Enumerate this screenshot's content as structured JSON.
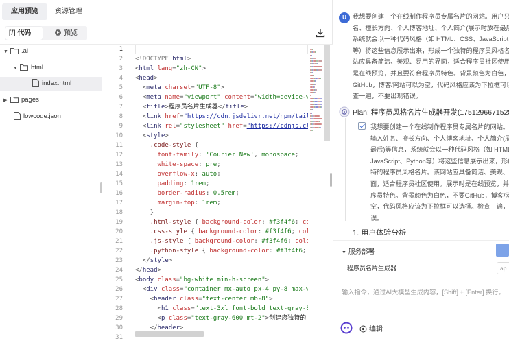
{
  "tabs": {
    "preview": "应用预览",
    "resources": "资源管理"
  },
  "view_switch": {
    "code": "[/] 代码",
    "preview": "预览"
  },
  "file_tree": {
    "items": [
      {
        "label": ".ai",
        "kind": "folder",
        "caret": "▼"
      },
      {
        "label": "html",
        "kind": "folder",
        "caret": "▼"
      },
      {
        "label": "index.html",
        "kind": "file",
        "caret": ""
      },
      {
        "label": "pages",
        "kind": "folder",
        "caret": "▶"
      },
      {
        "label": "lowcode.json",
        "kind": "file",
        "caret": ""
      }
    ]
  },
  "editor": {
    "active_line": 1,
    "line_numbers": [
      "1",
      "2",
      "3",
      "4",
      "5",
      "6",
      "7",
      "8",
      "9",
      "10",
      "11",
      "12",
      "13",
      "14",
      "15",
      "16",
      "17",
      "18",
      "19",
      "20",
      "21",
      "22",
      "23",
      "24",
      "25",
      "26",
      "27",
      "28",
      "29",
      "30",
      "31"
    ],
    "lines": [
      [],
      [
        [
          "tk-doct",
          "<!DOCTYPE "
        ],
        [
          "tk-tag",
          "html"
        ],
        [
          "tk-doct",
          ">"
        ]
      ],
      [
        [
          "tk-punct",
          "<"
        ],
        [
          "tk-tag",
          "html "
        ],
        [
          "tk-attr",
          "lang"
        ],
        [
          "tk-punct",
          "="
        ],
        [
          "tk-str",
          "\"zh-CN\""
        ],
        [
          "tk-punct",
          ">"
        ]
      ],
      [
        [
          "tk-punct",
          "<"
        ],
        [
          "tk-tag",
          "head"
        ],
        [
          "tk-punct",
          ">"
        ]
      ],
      [
        [
          "tk-punct",
          "  <"
        ],
        [
          "tk-tag",
          "meta "
        ],
        [
          "tk-attr",
          "charset"
        ],
        [
          "tk-punct",
          "="
        ],
        [
          "tk-str",
          "\"UTF-8\""
        ],
        [
          "tk-punct",
          ">"
        ]
      ],
      [
        [
          "tk-punct",
          "  <"
        ],
        [
          "tk-tag",
          "meta "
        ],
        [
          "tk-attr",
          "name"
        ],
        [
          "tk-punct",
          "="
        ],
        [
          "tk-str",
          "\"viewport\" "
        ],
        [
          "tk-attr",
          "content"
        ],
        [
          "tk-punct",
          "="
        ],
        [
          "tk-str",
          "\"width=device-width, initial-scale=1.0\""
        ]
      ],
      [
        [
          "tk-punct",
          "  <"
        ],
        [
          "tk-tag",
          "title"
        ],
        [
          "tk-punct",
          ">"
        ],
        [
          "tk-text",
          "程序员名片生成器"
        ],
        [
          "tk-punct",
          "</"
        ],
        [
          "tk-tag",
          "title"
        ],
        [
          "tk-punct",
          ">"
        ]
      ],
      [
        [
          "tk-punct",
          "  <"
        ],
        [
          "tk-tag",
          "link "
        ],
        [
          "tk-attr",
          "href"
        ],
        [
          "tk-punct",
          "="
        ],
        [
          "tk-link",
          "\"https://cdn.jsdelivr.net/npm/tailwindcss\""
        ]
      ],
      [
        [
          "tk-punct",
          "  <"
        ],
        [
          "tk-tag",
          "link "
        ],
        [
          "tk-attr",
          "rel"
        ],
        [
          "tk-punct",
          "="
        ],
        [
          "tk-str",
          "\"stylesheet\" "
        ],
        [
          "tk-attr",
          "href"
        ],
        [
          "tk-punct",
          "="
        ],
        [
          "tk-link",
          "\"https://cdnjs.cloudflare.com\""
        ]
      ],
      [
        [
          "tk-punct",
          "  <"
        ],
        [
          "tk-tag",
          "style"
        ],
        [
          "tk-punct",
          ">"
        ]
      ],
      [
        [
          "tk-sel",
          "    .code-style "
        ],
        [
          "tk-punct",
          "{"
        ]
      ],
      [
        [
          "tk-prop",
          "      font-family"
        ],
        [
          "tk-punct",
          ": "
        ],
        [
          "tk-val",
          "'Courier New'"
        ],
        [
          "tk-punct",
          ", "
        ],
        [
          "tk-val",
          "monospace"
        ],
        [
          "tk-punct",
          ";"
        ]
      ],
      [
        [
          "tk-prop",
          "      white-space"
        ],
        [
          "tk-punct",
          ": "
        ],
        [
          "tk-val",
          "pre"
        ],
        [
          "tk-punct",
          ";"
        ]
      ],
      [
        [
          "tk-prop",
          "      overflow-x"
        ],
        [
          "tk-punct",
          ": "
        ],
        [
          "tk-val",
          "auto"
        ],
        [
          "tk-punct",
          ";"
        ]
      ],
      [
        [
          "tk-prop",
          "      padding"
        ],
        [
          "tk-punct",
          ": "
        ],
        [
          "tk-val",
          "1rem"
        ],
        [
          "tk-punct",
          ";"
        ]
      ],
      [
        [
          "tk-prop",
          "      border-radius"
        ],
        [
          "tk-punct",
          ": "
        ],
        [
          "tk-val",
          "0.5rem"
        ],
        [
          "tk-punct",
          ";"
        ]
      ],
      [
        [
          "tk-prop",
          "      margin-top"
        ],
        [
          "tk-punct",
          ": "
        ],
        [
          "tk-val",
          "1rem"
        ],
        [
          "tk-punct",
          ";"
        ]
      ],
      [
        [
          "tk-punct",
          "    }"
        ]
      ],
      [
        [
          "tk-sel",
          "    .html-style "
        ],
        [
          "tk-punct",
          "{ "
        ],
        [
          "tk-prop",
          "background-color"
        ],
        [
          "tk-punct",
          ": "
        ],
        [
          "tk-val",
          "#f3f4f6"
        ],
        [
          "tk-punct",
          "; "
        ],
        [
          "tk-prop",
          "color"
        ]
      ],
      [
        [
          "tk-sel",
          "    .css-style "
        ],
        [
          "tk-punct",
          "{ "
        ],
        [
          "tk-prop",
          "background-color"
        ],
        [
          "tk-punct",
          ": "
        ],
        [
          "tk-val",
          "#f3f4f6"
        ],
        [
          "tk-punct",
          "; "
        ],
        [
          "tk-prop",
          "color"
        ]
      ],
      [
        [
          "tk-sel",
          "    .js-style "
        ],
        [
          "tk-punct",
          "{ "
        ],
        [
          "tk-prop",
          "background-color"
        ],
        [
          "tk-punct",
          ": "
        ],
        [
          "tk-val",
          "#f3f4f6"
        ],
        [
          "tk-punct",
          "; "
        ],
        [
          "tk-prop",
          "color"
        ]
      ],
      [
        [
          "tk-sel",
          "    .python-style "
        ],
        [
          "tk-punct",
          "{ "
        ],
        [
          "tk-prop",
          "background-color"
        ],
        [
          "tk-punct",
          ": "
        ],
        [
          "tk-val",
          "#f3f4f6"
        ],
        [
          "tk-punct",
          "; "
        ],
        [
          "tk-prop",
          "color"
        ]
      ],
      [
        [
          "tk-punct",
          "  </"
        ],
        [
          "tk-tag",
          "style"
        ],
        [
          "tk-punct",
          ">"
        ]
      ],
      [
        [
          "tk-punct",
          "</"
        ],
        [
          "tk-tag",
          "head"
        ],
        [
          "tk-punct",
          ">"
        ]
      ],
      [
        [
          "tk-punct",
          "<"
        ],
        [
          "tk-tag",
          "body "
        ],
        [
          "tk-attr",
          "class"
        ],
        [
          "tk-punct",
          "="
        ],
        [
          "tk-str",
          "\"bg-white min-h-screen\""
        ],
        [
          "tk-punct",
          ">"
        ]
      ],
      [
        [
          "tk-punct",
          "  <"
        ],
        [
          "tk-tag",
          "div "
        ],
        [
          "tk-attr",
          "class"
        ],
        [
          "tk-punct",
          "="
        ],
        [
          "tk-str",
          "\"container mx-auto px-4 py-8 max-w-4xl\""
        ]
      ],
      [
        [
          "tk-punct",
          "    <"
        ],
        [
          "tk-tag",
          "header "
        ],
        [
          "tk-attr",
          "class"
        ],
        [
          "tk-punct",
          "="
        ],
        [
          "tk-str",
          "\"text-center mb-8\""
        ],
        [
          "tk-punct",
          ">"
        ]
      ],
      [
        [
          "tk-punct",
          "      <"
        ],
        [
          "tk-tag",
          "h1 "
        ],
        [
          "tk-attr",
          "class"
        ],
        [
          "tk-punct",
          "="
        ],
        [
          "tk-str",
          "\"text-3xl font-bold text-gray-800\""
        ]
      ],
      [
        [
          "tk-punct",
          "      <"
        ],
        [
          "tk-tag",
          "p "
        ],
        [
          "tk-attr",
          "class"
        ],
        [
          "tk-punct",
          "="
        ],
        [
          "tk-str",
          "\"text-gray-600 mt-2\""
        ],
        [
          "tk-punct",
          ">"
        ],
        [
          "tk-text",
          "创建您独特的"
        ]
      ],
      [
        [
          "tk-punct",
          "    </"
        ],
        [
          "tk-tag",
          "header"
        ],
        [
          "tk-punct",
          ">"
        ]
      ],
      []
    ]
  },
  "chat": {
    "user_avatar": "U",
    "user_message_lines": [
      "我想要创建一个在线制作程序员专属名片的网站。用户只需",
      "名、擅长方向、个人博客地址、个人简介(展示时放在最后",
      "系统就会以一种代码风格（如 HTML、CSS、JavaScript、",
      "等）将这些信息展示出来，形成一个独特的程序员风格名片",
      "站应具备简洁、美观、易用的界面，适合程序员社区使用。",
      "是在线预览，并且要符合程序员特色。背景颜色为白色，不",
      "GitHub，博客/网站可以为空，代码风格应该为下拉框可以",
      "查一遍，不要出现错误。"
    ],
    "plan_title": "Plan: 程序员风格名片生成器开发(1751296671528)",
    "plan_task_lines": [
      "我想要创建一个在线制作程序员专属名片的网站。用",
      "输入姓名、擅长方向、个人博客地址、个人简介(展示",
      "最后)等信息，系统就会以一种代码风格（如 HTML、",
      "JavaScript、Python等）将这些信息展示出来，形成",
      "特的程序员风格名片。该网站应具备简洁、美观、易",
      "面，适合程序员社区使用。展示时是在线预览，并且",
      "序员特色。背景颜色为白色，不要GitHub，博客/网",
      "空，代码风格应该为下拉框可以选择。检查一遍，不",
      "误。"
    ],
    "section_heading": "1. 用户体验分析"
  },
  "deploy": {
    "title": "服务部署",
    "name": "程序员名片生成器",
    "input_value": "ap"
  },
  "composer": {
    "placeholder": "输入指令，通过AI大模型生成内容，[Shift] + [Enter] 换行。",
    "edit_label": "编辑"
  },
  "colors": {
    "accent": "#3d6bd6",
    "deploy_button": "#7da3e8"
  }
}
